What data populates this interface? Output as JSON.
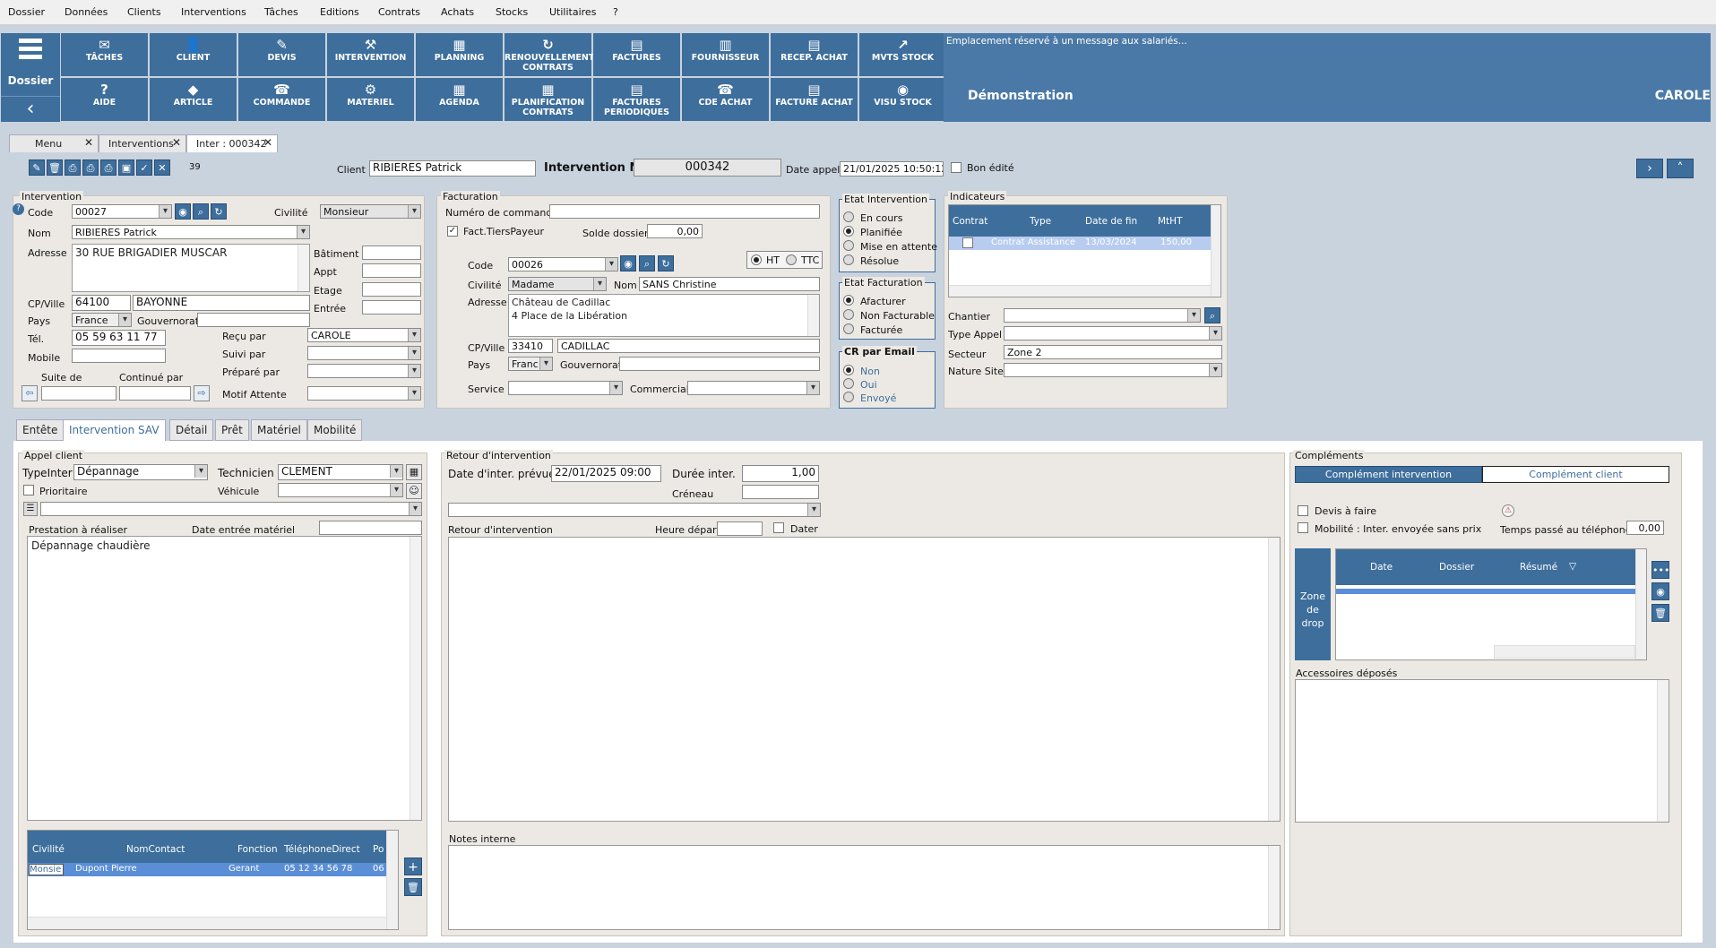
{
  "menu": [
    "Dossier",
    "Données",
    "Clients",
    "Interventions",
    "Tâches",
    "Editions",
    "Contrats",
    "Achats",
    "Stocks",
    "Utilitaires",
    "?"
  ],
  "toolbar": {
    "dossier_label": "Dossier",
    "row1": [
      {
        "label": "TÂCHES",
        "icon": "✉"
      },
      {
        "label": "CLIENT",
        "icon": "👤"
      },
      {
        "label": "DEVIS",
        "icon": "✎"
      },
      {
        "label": "INTERVENTION",
        "icon": "⚒"
      },
      {
        "label": "PLANNING",
        "icon": "▦"
      },
      {
        "label": "RENOUVELLEMENT CONTRATS",
        "icon": "↻"
      },
      {
        "label": "FACTURES",
        "icon": "▤"
      },
      {
        "label": "FOURNISSEUR",
        "icon": "▥"
      },
      {
        "label": "RECEP. ACHAT",
        "icon": "▤"
      },
      {
        "label": "MVTS STOCK",
        "icon": "↗"
      }
    ],
    "row2": [
      {
        "label": "AIDE",
        "icon": "?"
      },
      {
        "label": "ARTICLE",
        "icon": "◆"
      },
      {
        "label": "COMMANDE",
        "icon": "☎"
      },
      {
        "label": "MATERIEL",
        "icon": "⚙"
      },
      {
        "label": "AGENDA",
        "icon": "▦"
      },
      {
        "label": "PLANIFICATION CONTRATS",
        "icon": "▦"
      },
      {
        "label": "FACTURES PERIODIQUES",
        "icon": "▤"
      },
      {
        "label": "CDE ACHAT",
        "icon": "☎"
      },
      {
        "label": "FACTURE ACHAT",
        "icon": "▤"
      },
      {
        "label": "VISU STOCK",
        "icon": "◉"
      }
    ]
  },
  "message_panel": {
    "message": "Emplacement réservé à un  message aux salariés...",
    "company": "Démonstration",
    "user": "CAROLE"
  },
  "tabs": [
    {
      "label": "Menu"
    },
    {
      "label": "Interventions"
    },
    {
      "label": "Inter : 000342"
    }
  ],
  "header": {
    "count": "39",
    "client_label": "Client",
    "client": "RIBIERES Patrick",
    "inter_label": "Intervention N°",
    "inter_no": "000342",
    "date_label": "Date appel",
    "date": "21/01/2025 10:50:12",
    "bon_edite": "Bon édité"
  },
  "intervention": {
    "title": "Intervention",
    "code_label": "Code",
    "code": "00027",
    "civ_label": "Civilité",
    "civ": "Monsieur",
    "nom_label": "Nom",
    "nom": "RIBIERES Patrick",
    "adresse_label": "Adresse",
    "adresse": "30 RUE BRIGADIER MUSCAR",
    "batiment": "Bâtiment",
    "appt": "Appt",
    "etage": "Etage",
    "entree": "Entrée",
    "cp_label": "CP/Ville",
    "cp": "64100",
    "ville": "BAYONNE",
    "pays_label": "Pays",
    "pays": "France",
    "gouv_label": "Gouvernorat",
    "tel_label": "Tél.",
    "tel": "05 59 63 11 77",
    "mobile_label": "Mobile",
    "recu_label": "Reçu par",
    "recu": "CAROLE",
    "suivi_label": "Suivi par",
    "prepare_label": "Préparé par",
    "motif_label": "Motif Attente",
    "suite_label": "Suite de",
    "continue_label": "Continué par"
  },
  "facturation": {
    "title": "Facturation",
    "num_cmd_label": "Numéro de commande",
    "tiers": "Fact.TiersPayeur",
    "solde_label": "Solde dossier",
    "solde": "0,00",
    "code_label": "Code",
    "code": "00026",
    "ht": "HT",
    "ttc": "TTC",
    "civ_label": "Civilité",
    "civ": "Madame",
    "nom_label": "Nom",
    "nom": "SANS Christine",
    "adresse_label": "Adresse",
    "adresse1": "Château de Cadillac",
    "adresse2": "4 Place de la Libération",
    "cp_label": "CP/Ville",
    "cp": "33410",
    "ville": "CADILLAC",
    "pays_label": "Pays",
    "pays": "Franc",
    "gouv_label": "Gouvernorat",
    "service_label": "Service",
    "commercial_label": "Commercial"
  },
  "etat_intervention": {
    "title": "Etat Intervention",
    "options": [
      "En cours",
      "Planifiée",
      "Mise en attente",
      "Résolue"
    ]
  },
  "etat_facturation": {
    "title": "Etat Facturation",
    "options": [
      "Afacturer",
      "Non Facturable",
      "Facturée"
    ]
  },
  "cr_email": {
    "title": "CR par Email",
    "options": [
      "Non",
      "Oui",
      "Envoyé"
    ]
  },
  "indicateurs": {
    "title": "Indicateurs",
    "columns": [
      "Contrat",
      "Type",
      "Date de fin",
      "MtHT"
    ],
    "row": {
      "type": "Contrat Assistance",
      "date": "13/03/2024",
      "mtht": "150,00"
    },
    "chantier_label": "Chantier",
    "type_appel_label": "Type Appel",
    "secteur_label": "Secteur",
    "secteur": "Zone 2",
    "nature_label": "Nature Site"
  },
  "tabs2": [
    "Entête",
    "Intervention SAV",
    "Détail",
    "Prêt",
    "Matériel",
    "Mobilité"
  ],
  "appel": {
    "title": "Appel client",
    "type_label": "TypeInter",
    "type": "Dépannage",
    "tech_label": "Technicien",
    "tech": "CLEMENT",
    "prio": "Prioritaire",
    "vehicule_label": "Véhicule",
    "prestation_label": "Prestation à réaliser",
    "date_entree_label": "Date entrée matériel",
    "prestation": "Dépannage chaudière",
    "contacts_cols": [
      "Civilité",
      "NomContact",
      "Fonction",
      "TéléphoneDirect",
      "Po"
    ],
    "contact": {
      "civ": "Monsie",
      "nom": "Dupont Pierre",
      "fonction": "Gerant",
      "tel": "05 12 34 56 78",
      "po": "06"
    }
  },
  "retour": {
    "title": "Retour d'intervention",
    "date_label": "Date d'inter. prévue",
    "date": "22/01/2025 09:00",
    "duree_label": "Durée inter.",
    "duree": "1,00",
    "creneau_label": "Créneau",
    "retour_label": "Retour d'intervention",
    "depart_label": "Heure départ",
    "dater": "Dater",
    "notes_label": "Notes interne"
  },
  "complements": {
    "title": "Compléments",
    "tab1": "Complément intervention",
    "tab2": "Complément client",
    "devis": "Devis à faire",
    "mobilite": "Mobilité : Inter. envoyée sans prix",
    "temps_label": "Temps passé au téléphone",
    "temps": "0,00",
    "drop": "Zone de drop",
    "cols": [
      "Date",
      "Dossier",
      "Résumé"
    ],
    "accessoires": "Accessoires déposés"
  }
}
